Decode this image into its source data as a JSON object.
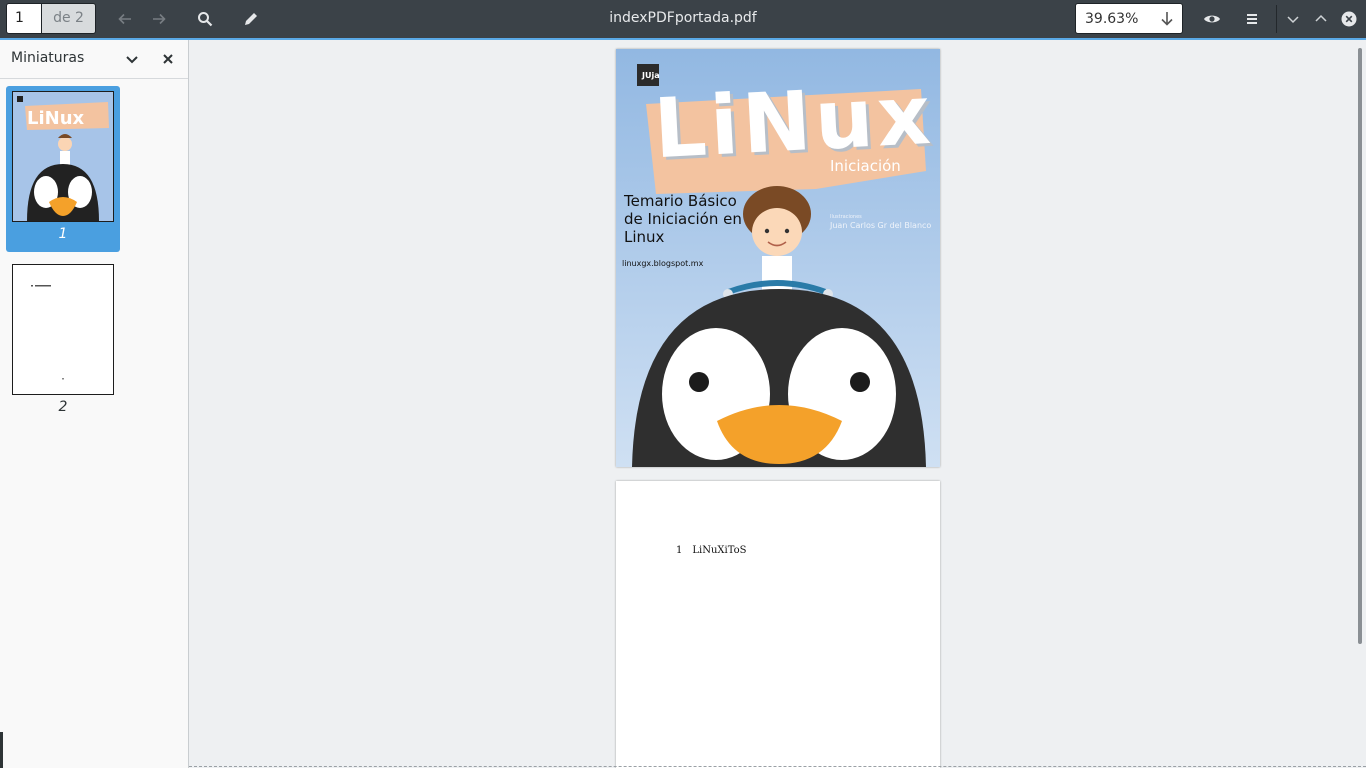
{
  "header": {
    "page_number": "1",
    "page_of": "de 2",
    "title": "indexPDFportada.pdf",
    "zoom": "39.63%"
  },
  "sidebar": {
    "title": "Miniaturas",
    "thumbnails": [
      {
        "label": "1",
        "selected": true
      },
      {
        "label": "2",
        "selected": false
      }
    ]
  },
  "cover": {
    "logo_text": "JUja",
    "title": "LiNux",
    "subtitle": "Iniciación",
    "heading_line1": "Temario Básico",
    "heading_line2": "de Iniciación en",
    "heading_line3": "Linux",
    "url": "linuxgx.blogspot.mx",
    "credit_label": "Ilustraciones",
    "credit_name": "Juan Carlos Gr del Blanco"
  },
  "page2": {
    "toc_number": "1",
    "toc_entry": "LiNuXiToS"
  },
  "colors": {
    "headerbar": "#3b4248",
    "accent": "#5aa9e6",
    "selection": "#4a9fe0",
    "cover_sky": "#92b8e2",
    "banner": "#f3c3a0",
    "beak": "#f4a12a"
  }
}
